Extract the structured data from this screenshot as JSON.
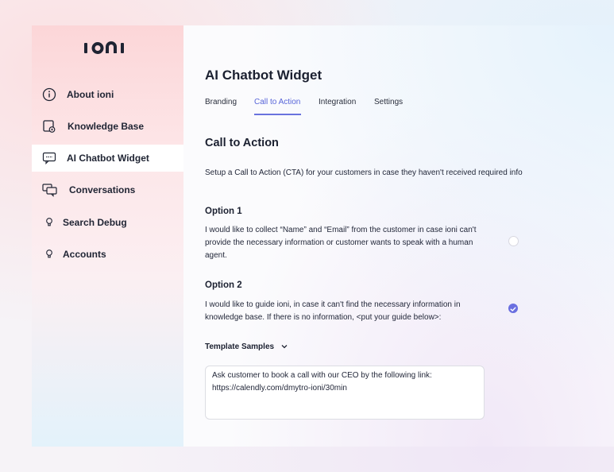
{
  "brand": {
    "logo_text": "ioni"
  },
  "sidebar": {
    "items": [
      {
        "label": "About ioni",
        "icon": "info-icon"
      },
      {
        "label": "Knowledge Base",
        "icon": "knowledge-base-icon"
      },
      {
        "label": "AI Chatbot Widget",
        "icon": "chat-widget-icon",
        "active": true
      },
      {
        "label": "Conversations",
        "icon": "conversations-icon"
      },
      {
        "label": "Search Debug",
        "icon": "bulb-icon"
      },
      {
        "label": "Accounts",
        "icon": "bulb-icon"
      }
    ]
  },
  "page": {
    "title": "AI Chatbot Widget"
  },
  "tabs": [
    {
      "label": "Branding"
    },
    {
      "label": "Call to Action",
      "active": true
    },
    {
      "label": "Integration"
    },
    {
      "label": "Settings"
    }
  ],
  "section": {
    "title": "Call to Action",
    "description": "Setup a Call to Action (CTA) for your customers in case they haven't received required info"
  },
  "option1": {
    "title": "Option 1",
    "text_line1": "I would like to collect “Name” and “Email” from the customer in case ioni can't",
    "text_line2": "provide the necessary information or customer wants to speak with a human",
    "text_line3": "agent.",
    "selected": false
  },
  "option2": {
    "title": "Option 2",
    "text_line1": "I would like to guide ioni, in case it can't find the necessary information in",
    "text_line2": "knowledge base. If there is no information, <put your guide below>:",
    "selected": true
  },
  "template_samples": {
    "label": "Template Samples"
  },
  "guide_text": {
    "line1": "Ask customer to book a call with our CEO by the following link:",
    "line2": "https://calendly.com/dmytro-ioni/30min"
  },
  "colors": {
    "accent": "#6a6fe0",
    "active_tab": "#5865d9"
  }
}
